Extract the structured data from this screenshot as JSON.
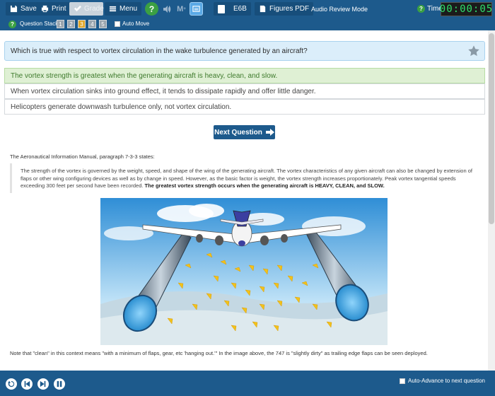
{
  "toolbar": {
    "save_label": "Save",
    "print_label": "Print",
    "grade_label": "Grade",
    "menu_label": "Menu",
    "e6b_label": "E6B",
    "figures_label": "Figures PDF",
    "audio_label": "Audio Review Mode",
    "m_label": "M",
    "time_label": "Time",
    "timer_value": "00:00:05"
  },
  "stack": {
    "label": "Question Stack:",
    "numbers": [
      "1",
      "2",
      "3",
      "4",
      "5"
    ],
    "current_index": 2,
    "auto_move_label": "Auto Move"
  },
  "question": {
    "text": "Which is true with respect to vortex circulation in the wake turbulence generated by an aircraft?"
  },
  "answers": [
    {
      "text": "The vortex strength is greatest when the generating aircraft is heavy, clean, and slow.",
      "correct": true
    },
    {
      "text": "When vortex circulation sinks into ground effect, it tends to dissipate rapidly and offer little danger.",
      "correct": false
    },
    {
      "text": "Helicopters generate downwash turbulence only, not vortex circulation.",
      "correct": false
    }
  ],
  "next_button": {
    "label": "Next Question"
  },
  "explanation": {
    "intro": "The Aeronautical Information Manual, paragraph 7-3-3 states:",
    "quote_plain": "The strength of the vortex is governed by the weight, speed, and shape of the wing of the generating aircraft. The vortex characteristics of any given aircraft can also be changed by extension of flaps or other wing configuring devices as well as by change in speed. However, as the basic factor is weight, the vortex strength increases proportionately. Peak vortex tangential speeds exceeding 300 feet per second have been recorded. ",
    "quote_bold": "The greatest vortex strength occurs when the generating aircraft is HEAVY, CLEAN, and SLOW.",
    "note": "Note that \"clean\" in this context means \"with a minimum of flaps, gear, etc 'hanging out.'\" In the image above, the 747 is \"slightly dirty\" as trailing edge flaps can be seen deployed."
  },
  "bottom": {
    "auto_advance_label": "Auto-Advance to next question"
  },
  "colors": {
    "toolbar": "#1d5a8c",
    "correct_bg": "#dff0d4",
    "question_bg": "#dbeefa",
    "timer_text": "#2ee06a"
  }
}
